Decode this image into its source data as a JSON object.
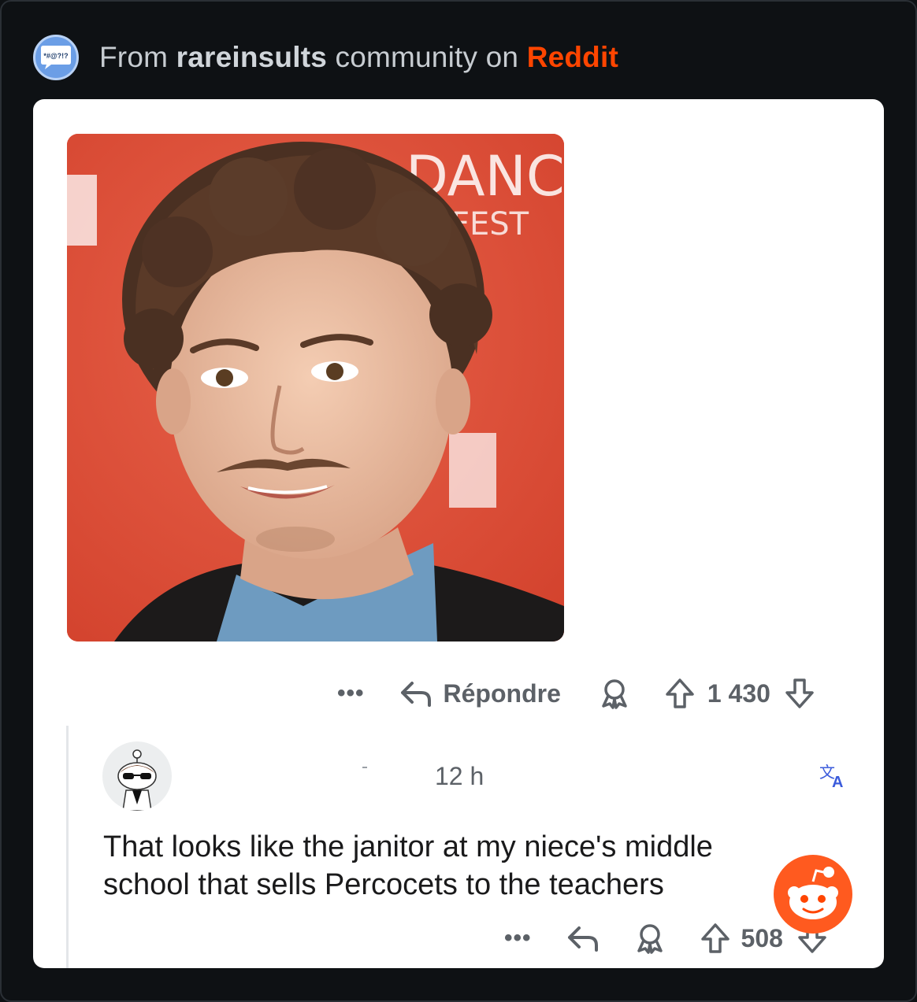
{
  "header": {
    "prefix": "From ",
    "community": "rareinsults",
    "middle": " community on ",
    "brand": "Reddit",
    "avatar_icon": "speech-bubble-symbols-icon",
    "avatar_glyph": "*#@?!?"
  },
  "post": {
    "image_text_top": "DANC",
    "image_text_mid": "FEST",
    "actions": {
      "more": "•••",
      "reply_label": "Répondre",
      "award_icon": "award-icon",
      "score": "1 430"
    }
  },
  "comment": {
    "time": "12 h",
    "translate_icon": "translate-icon",
    "text": "That looks like the janitor at my niece's middle school that sells Percocets to the teachers",
    "actions": {
      "more": "•••",
      "score": "508"
    }
  },
  "colors": {
    "background": "#0e1114",
    "card": "#ffffff",
    "brand": "#ff4500",
    "muted": "#5c6167"
  }
}
